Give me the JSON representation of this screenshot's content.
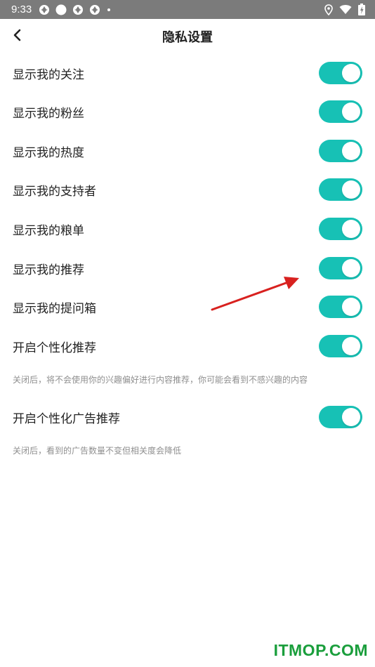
{
  "status_bar": {
    "time": "9:33",
    "left_icons": [
      "aperture-icon",
      "circle-icon",
      "aperture-icon",
      "aperture-icon",
      "dot-icon"
    ],
    "right_icons": [
      "location-icon",
      "wifi-icon",
      "battery-charging-icon"
    ],
    "background": "#7b7b7b"
  },
  "header": {
    "back_icon": "chevron-left-icon",
    "title": "隐私设置"
  },
  "settings": [
    {
      "label": "显示我的关注",
      "enabled": true
    },
    {
      "label": "显示我的粉丝",
      "enabled": true
    },
    {
      "label": "显示我的热度",
      "enabled": true
    },
    {
      "label": "显示我的支持者",
      "enabled": true
    },
    {
      "label": "显示我的粮单",
      "enabled": true
    },
    {
      "label": "显示我的推荐",
      "enabled": true
    },
    {
      "label": "显示我的提问箱",
      "enabled": true
    },
    {
      "label": "开启个性化推荐",
      "enabled": true,
      "hint": "关闭后，将不会使用你的兴趣偏好进行内容推荐，你可能会看到不感兴趣的内容"
    },
    {
      "label": "开启个性化广告推荐",
      "enabled": true,
      "hint": "关闭后，看到的广告数量不变但相关度会降低"
    }
  ],
  "colors": {
    "toggle_on": "#17c1b5",
    "annotation_arrow": "#d8211f",
    "watermark": "#1a9e3c"
  },
  "watermark": "ITMOP.COM"
}
